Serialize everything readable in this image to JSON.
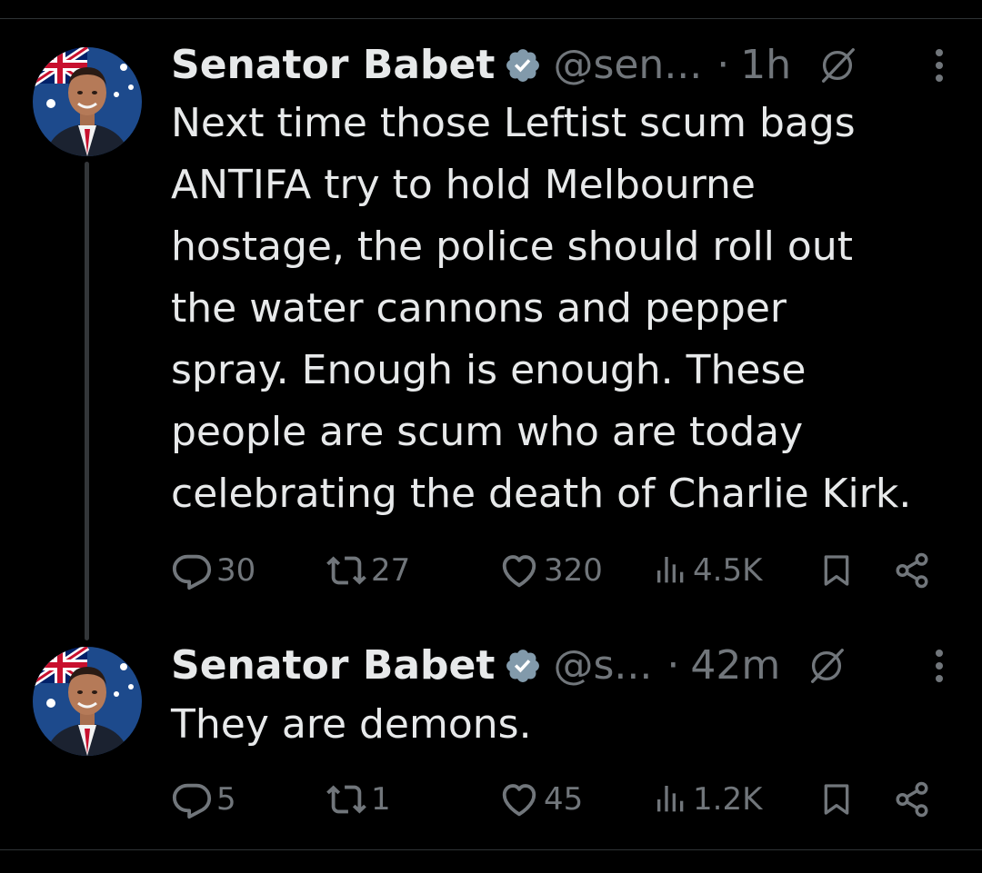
{
  "colors": {
    "background": "#000000",
    "text_primary": "#e7e9ea",
    "text_secondary": "#71767b",
    "verified_badge": "#829aab",
    "divider": "#2f3336"
  },
  "tweets": [
    {
      "display_name": "Senator Babet",
      "handle": "@sen...",
      "separator": "·",
      "time": "1h",
      "text": "Next time those Leftist scum bags\nANTIFA try to hold Melbourne\nhostage, the police should roll out\nthe water cannons and pepper\nspray. Enough is enough. These\npeople are scum who are today\ncelebrating the death of Charlie Kirk.",
      "replies": "30",
      "reposts": "27",
      "likes": "320",
      "views": "4.5K",
      "icons": [
        "verified-badge-icon",
        "grok-icon",
        "more-icon",
        "reply-icon",
        "repost-icon",
        "like-icon",
        "views-icon",
        "bookmark-icon",
        "share-icon"
      ]
    },
    {
      "display_name": "Senator Babet",
      "handle": "@s...",
      "separator": "·",
      "time": "42m",
      "text": "They are demons.",
      "replies": "5",
      "reposts": "1",
      "likes": "45",
      "views": "1.2K",
      "icons": [
        "verified-badge-icon",
        "grok-icon",
        "more-icon",
        "reply-icon",
        "repost-icon",
        "like-icon",
        "views-icon",
        "bookmark-icon",
        "share-icon"
      ]
    }
  ]
}
